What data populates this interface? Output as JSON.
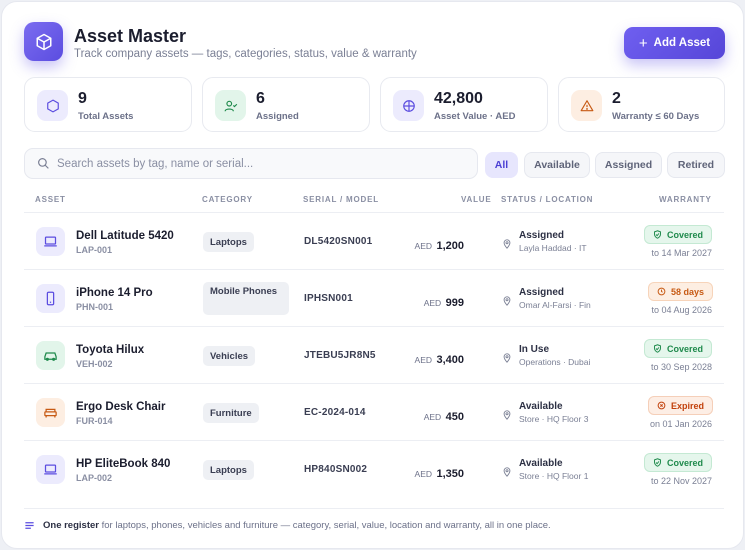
{
  "header": {
    "title": "Asset Master",
    "subtitle": "Track company assets — tags, categories, status, value & warranty",
    "add_button_label": "Add Asset"
  },
  "stats": [
    {
      "value": "9",
      "label": "Total Assets",
      "icon": "cube-icon"
    },
    {
      "value": "6",
      "label": "Assigned",
      "icon": "user-check-icon"
    },
    {
      "value": "42,800",
      "label": "Asset Value · AED",
      "icon": "coin-icon"
    },
    {
      "value": "2",
      "label": "Warranty ≤ 60 Days",
      "icon": "warning-icon"
    }
  ],
  "search": {
    "placeholder": "Search assets by tag, name or serial...",
    "value": ""
  },
  "filters": [
    "All",
    "Available",
    "Assigned",
    "Retired"
  ],
  "active_filter": "All",
  "table": {
    "columns": [
      "ASSET",
      "CATEGORY",
      "SERIAL / MODEL",
      "VALUE",
      "STATUS / LOCATION",
      "WARRANTY"
    ],
    "rows": [
      {
        "name": "Dell Latitude 5420",
        "tag": "LAP-001",
        "category": "Laptops",
        "serial": "DL5420SN001",
        "currency": "AED",
        "amount": "1,200",
        "status": "Assigned",
        "location": "Layla Haddad · IT",
        "warranty": "Covered",
        "warranty_kind": "green",
        "warranty_date": "to 14 Mar 2027",
        "icon": "laptop-icon"
      },
      {
        "name": "iPhone 14 Pro",
        "tag": "PHN-001",
        "category": "Mobile Phones",
        "serial": "IPHSN001",
        "currency": "AED",
        "amount": "999",
        "status": "Assigned",
        "location": "Omar Al-Farsi · Fin",
        "warranty": "58 days",
        "warranty_kind": "orange",
        "warranty_date": "to 04 Aug 2026",
        "icon": "phone-icon"
      },
      {
        "name": "Toyota Hilux",
        "tag": "VEH-002",
        "category": "Vehicles",
        "serial": "JTEBU5JR8N5",
        "currency": "AED",
        "amount": "3,400",
        "status": "In Use",
        "location": "Operations · Dubai",
        "warranty": "Covered",
        "warranty_kind": "green",
        "warranty_date": "to 30 Sep 2028",
        "icon": "car-icon"
      },
      {
        "name": "Ergo Desk Chair",
        "tag": "FUR-014",
        "category": "Furniture",
        "serial": "EC-2024-014",
        "currency": "AED",
        "amount": "450",
        "status": "Available",
        "location": "Store · HQ Floor 3",
        "warranty": "Expired",
        "warranty_kind": "red",
        "warranty_date": "on 01 Jan 2026",
        "icon": "sofa-icon"
      },
      {
        "name": "HP EliteBook 840",
        "tag": "LAP-002",
        "category": "Laptops",
        "serial": "HP840SN002",
        "currency": "AED",
        "amount": "1,350",
        "status": "Available",
        "location": "Store · HQ Floor 1",
        "warranty": "Covered",
        "warranty_kind": "green",
        "warranty_date": "to 22 Nov 2027",
        "icon": "laptop-icon"
      }
    ]
  },
  "footer": {
    "strong": "One register",
    "text": "for laptops, phones, vehicles and furniture — category, serial, value, location and warranty, all in one place."
  },
  "colors": {
    "accent": "#5b4de0",
    "green": "#1f8a4c",
    "orange": "#c75a14"
  }
}
